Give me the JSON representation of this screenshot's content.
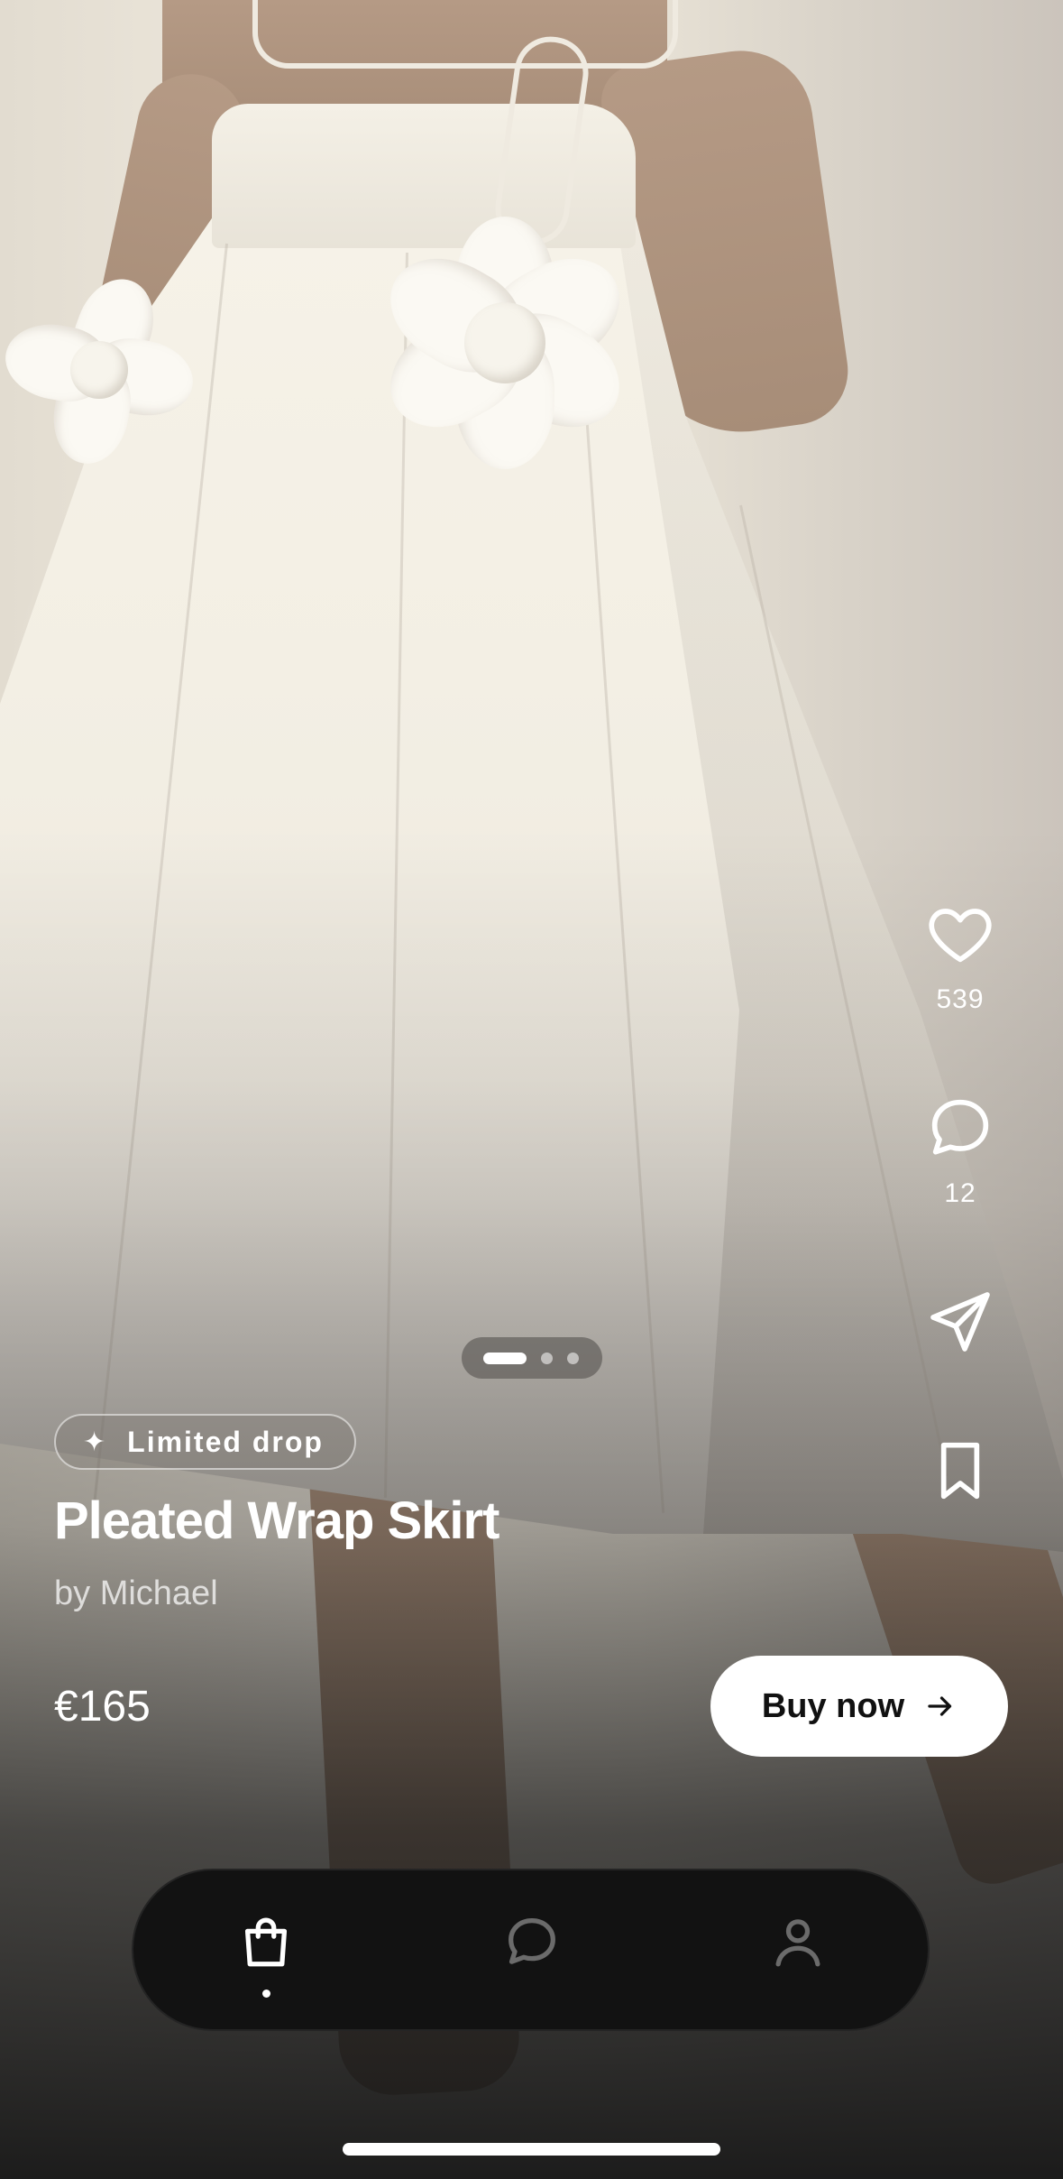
{
  "product": {
    "badge": "Limited drop",
    "badge_icon": "sparkle-icon",
    "name": "Pleated Wrap Skirt",
    "byline": "by Michael",
    "price": "€165",
    "buy_label": "Buy now"
  },
  "actions": {
    "likes": "539",
    "comments": "12"
  },
  "gallery": {
    "pages": 3,
    "active_page": 1
  },
  "nav": {
    "items": [
      "shop",
      "messages",
      "profile"
    ],
    "active": "shop"
  },
  "colors": {
    "buy_button_bg": "#FFFFFF",
    "nav_bg": "#121212",
    "text_primary": "#FFFFFF"
  }
}
